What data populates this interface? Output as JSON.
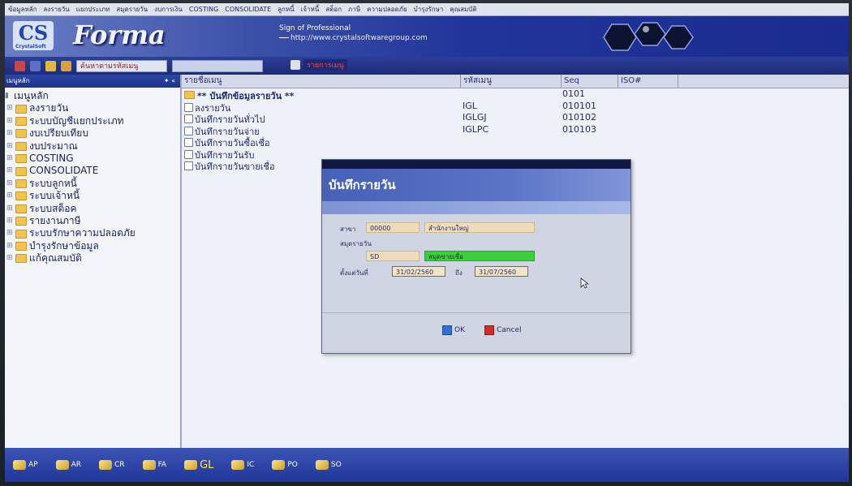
{
  "menubar": {
    "items": [
      "ข้อมูลหลัก",
      "ลงรายวัน",
      "แยกประเภท",
      "สมุดรายวัน",
      "งบการเงิน",
      "COSTING",
      "CONSOLIDATE",
      "ลูกหนี้",
      "เจ้าหนี้",
      "สต็อก",
      "ภาษี",
      "ความปลอดภัย",
      "บำรุงรักษา",
      "คุณสมบัติ"
    ]
  },
  "banner": {
    "logo_cs": "CS",
    "logo_cs_sub": "CrystalSoft",
    "logo_forma": "Forma",
    "sign": "Sign of Professional",
    "url": "http://www.crystalsoftwaregroup.com"
  },
  "toolbar": {
    "search_field": "ค้นหาตามรหัสเมนู",
    "menu_item_text": "รายการเมนู"
  },
  "left_panel": {
    "header": "เมนูหลัก",
    "pins": "✦ «",
    "root": "เมนูหลัก",
    "items": [
      "ลงรายวัน",
      "ระบบบัญชีแยกประเภท",
      "งบเปรียบเทียบ",
      "งบประมาณ",
      "COSTING",
      "CONSOLIDATE",
      "ระบบลูกหนี้",
      "ระบบเจ้าหนี้",
      "ระบบสต็อค",
      "รายงานภาษี",
      "ระบบรักษาความปลอดภัย",
      "บำรุงรักษาข้อมูล",
      "แก้คุณสมบัติ"
    ]
  },
  "grid": {
    "headers": [
      "รายชื่อเมนู",
      "รหัสเมนู",
      "Seq",
      "ISO#"
    ],
    "rows": [
      {
        "name": "** บันทึกข้อมูลรายวัน **",
        "code": "",
        "seq": "0101",
        "bold": true
      },
      {
        "name": "ลงรายวัน",
        "code": "IGL",
        "seq": "010101",
        "bold": false
      },
      {
        "name": "บันทึกรายวันทั่วไป",
        "code": "IGLGJ",
        "seq": "010102",
        "bold": false
      },
      {
        "name": "บันทึกรายวันจ่าย",
        "code": "IGLPC",
        "seq": "010103",
        "bold": false
      },
      {
        "name": "บันทึกรายวันซื้อเชื่อ",
        "code": "",
        "seq": "",
        "bold": false
      },
      {
        "name": "บันทึกรายวันรับ",
        "code": "",
        "seq": "",
        "bold": false
      },
      {
        "name": "บันทึกรายวันขายเชื่อ",
        "code": "",
        "seq": "",
        "bold": false
      }
    ]
  },
  "dialog": {
    "title": "บันทึกรายวัน",
    "branch_label": "สาขา",
    "branch_code": "00000",
    "branch_name": "สำนักงานใหญ่",
    "journal_label": "สมุดรายวัน",
    "journal_code": "SD",
    "journal_name": "สมุดขายเชื่อ",
    "from_label": "ตั้งแต่วันที่",
    "from_date": "31/02/2560",
    "to_label": "ถึง",
    "to_date": "31/07/2560",
    "ok_label": "OK",
    "cancel_label": "Cancel"
  },
  "bottombar": {
    "modules": [
      "AP",
      "AR",
      "CR",
      "FA",
      "GL",
      "IC",
      "PO",
      "SO"
    ],
    "active": "GL"
  },
  "colors": {
    "banner_blue": "#21349a",
    "green_field": "#3ccf3c",
    "tan_field": "#efdcbb"
  }
}
